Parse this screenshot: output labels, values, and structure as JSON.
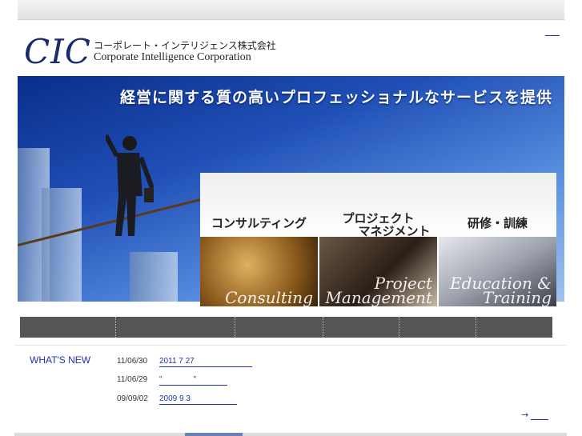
{
  "header": {
    "logo": "CIC",
    "name_jp": "コーポレート・インテリジェンス株式会社",
    "name_en": "Corporate Intelligence Corporation"
  },
  "hero": {
    "tagline": "経営に関する質の高いプロフェッショナルなサービスを提供"
  },
  "services": [
    {
      "label_line1": "コンサルティング",
      "label_line2": "",
      "script": "Consulting",
      "color": "#8a5a1c"
    },
    {
      "label_line1": "プロジェクト",
      "label_line2": "マネジメント",
      "script": "Project Management",
      "color": "#3b2a1e"
    },
    {
      "label_line1": "研修・訓練",
      "label_line2": "",
      "script": "Education & Training",
      "color": "#b7b7bd"
    }
  ],
  "whats_new": {
    "title": "WHAT'S NEW",
    "items": [
      {
        "date": "11/06/30",
        "text": "2011 7 27                          "
      },
      {
        "date": "11/06/29",
        "text": "\"              \"              "
      },
      {
        "date": "09/09/02",
        "text": "2009 9 3                     "
      }
    ],
    "more_arrow": "→"
  },
  "colors": {
    "accent": "#2233aa",
    "nav": "#555555",
    "hero": "#1f4fb6"
  }
}
